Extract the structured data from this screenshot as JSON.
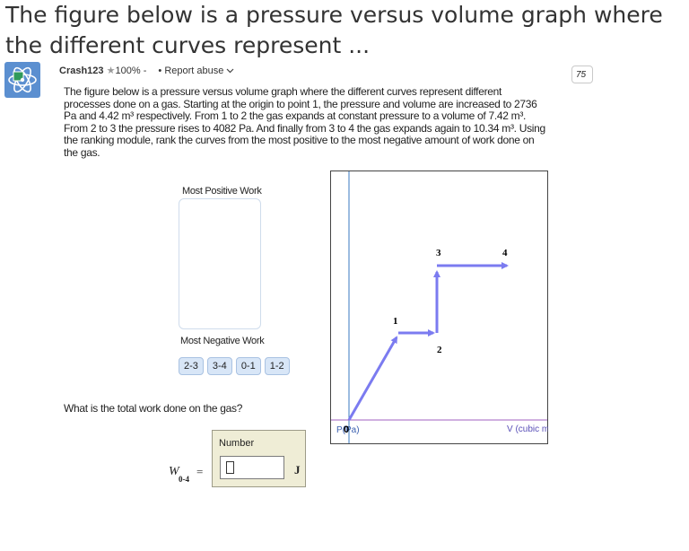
{
  "page_title": "The figure below is a pressure versus volume graph where the different curves represent ...",
  "author": {
    "name": "Crash123",
    "rating": "100%",
    "rating_suffix": "-",
    "report": "• Report abuse"
  },
  "page_badge": "75",
  "question_text": "The figure below is a pressure versus volume graph where the different curves represent different processes done on a gas. Starting at the origin to point 1, the pressure and volume are increased to 2736 Pa and 4.42 m³ respectively. From 1 to 2 the gas expands at constant pressure to a volume of 7.42 m³. From 2 to 3 the pressure rises to 4082 Pa. And finally from 3 to 4 the gas expands again to 10.34 m³. Using the ranking module, rank the curves from the most positive to the most negative amount of work done on the gas.",
  "ranking": {
    "top_label": "Most Positive Work",
    "bottom_label": "Most Negative Work",
    "chips": [
      "2-3",
      "3-4",
      "0-1",
      "1-2"
    ]
  },
  "question2": "What is the total work done on the gas?",
  "answer": {
    "panel_label": "Number",
    "value": "",
    "unit": "J",
    "symbol": "W",
    "subscript": "0-4",
    "equals": "="
  },
  "graph": {
    "y_axis_label": "P(Pa)",
    "origin_label": "0",
    "x_axis_label": "V (cubic m",
    "point_labels": [
      "1",
      "2",
      "3",
      "4"
    ]
  },
  "colors": {
    "path": "#7b7bf0",
    "axis_x": "#a060c0",
    "axis_y": "#3a78c0",
    "avatar": "#5b8fd0",
    "chip": "#d8e6f7"
  }
}
